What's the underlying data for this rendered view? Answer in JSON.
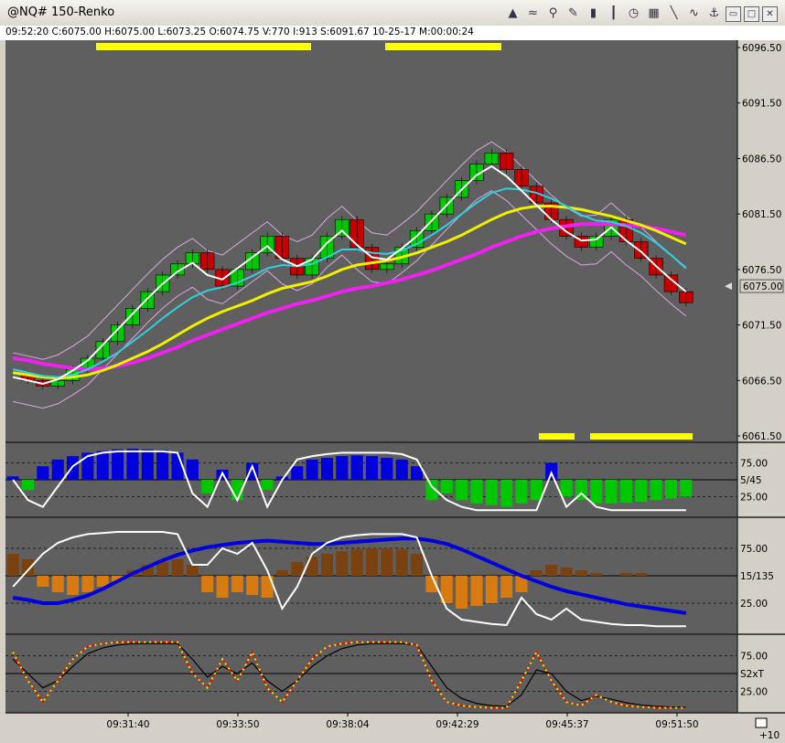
{
  "window": {
    "title": "@NQ# 150-Renko"
  },
  "toolbar": {
    "icons": [
      "chart-type-icon",
      "wave-lines-icon",
      "indicator-icon",
      "pencil-icon",
      "bar-chart-icon",
      "candle-icon",
      "clock-icon",
      "grid-icon",
      "draw-line-icon",
      "trend-icon",
      "pin-icon",
      "restore-icon",
      "maximize-icon",
      "close-icon"
    ],
    "glyphs": [
      "▲",
      "≈",
      "⚲",
      "✎",
      "▮",
      "┃",
      "◷",
      "▦",
      "╲",
      "∿",
      "⚓",
      "▭",
      "□",
      "✕"
    ]
  },
  "info_bar": {
    "text": "09:52:20  C:6075.00  H:6075.00  L:6073.25  O:6074.75  V:770  I:913  S:6091.67  10-25-17  M:00:00:24"
  },
  "price_axis": {
    "ticks": [
      "6096.50",
      "6091.50",
      "6086.50",
      "6081.50",
      "6076.50",
      "6071.50",
      "6066.50",
      "6061.50"
    ],
    "current_price": "6075.00"
  },
  "time_axis": {
    "ticks": [
      "09:31:40",
      "09:33:50",
      "09:38:04",
      "09:42:29",
      "09:45:37",
      "09:51:50"
    ]
  },
  "panels": {
    "panel1": {
      "levels": [
        "75.00",
        "5/45",
        "25.00"
      ]
    },
    "panel2": {
      "levels": [
        "75.00",
        "15/135",
        "25.00"
      ]
    },
    "panel3": {
      "levels": [
        "75.00",
        "S2xT",
        "25.00"
      ]
    }
  },
  "corner_label": "+10",
  "colors": {
    "up": "#00c800",
    "down": "#c80000",
    "sma_fast": "#ffffff",
    "ma_cyan": "#30d0e0",
    "ma_yellow": "#f0f000",
    "ma_magenta": "#f020f0",
    "envelope": "#d8a8e0",
    "bg": "#5f5f5f",
    "osc_blue": "#0000dd",
    "osc_orange": "#d77a10",
    "osc_brown": "#7a4210"
  },
  "chart_data": {
    "type": "renko",
    "title": "@NQ# 150-Renko",
    "ylim": [
      6061.5,
      6096.5
    ],
    "price_path": [
      6067.0,
      6066.5,
      6066.0,
      6066.5,
      6067.5,
      6068.5,
      6070.0,
      6071.5,
      6073.0,
      6074.5,
      6076.0,
      6077.0,
      6078.0,
      6076.5,
      6075.0,
      6076.5,
      6078.0,
      6079.5,
      6077.5,
      6076.0,
      6077.5,
      6079.5,
      6081.0,
      6078.5,
      6076.5,
      6077.0,
      6078.5,
      6080.0,
      6081.5,
      6083.0,
      6084.5,
      6086.0,
      6087.0,
      6085.5,
      6084.0,
      6082.5,
      6081.0,
      6079.5,
      6078.5,
      6079.5,
      6081.0,
      6079.0,
      6077.5,
      6076.0,
      6074.5,
      6073.5
    ],
    "ma_fast": [
      6066.8,
      6066.5,
      6066.2,
      6066.6,
      6067.4,
      6068.3,
      6069.7,
      6071.1,
      6072.5,
      6073.9,
      6075.2,
      6076.3,
      6077.1,
      6076.0,
      6075.6,
      6076.6,
      6077.6,
      6078.6,
      6077.4,
      6076.8,
      6077.4,
      6078.9,
      6080.0,
      6078.7,
      6077.6,
      6077.4,
      6078.4,
      6079.5,
      6080.9,
      6082.3,
      6083.7,
      6085.0,
      6085.8,
      6084.9,
      6083.6,
      6082.3,
      6081.0,
      6079.9,
      6079.1,
      6079.2,
      6080.3,
      6079.1,
      6078.1,
      6076.8,
      6075.6,
      6074.5
    ],
    "ma_cyan": [
      6067.5,
      6067.2,
      6066.9,
      6066.8,
      6067.0,
      6067.5,
      6068.2,
      6069.0,
      6070.0,
      6071.0,
      6072.1,
      6073.1,
      6074.0,
      6074.6,
      6074.9,
      6075.3,
      6075.9,
      6076.6,
      6076.9,
      6076.8,
      6077.0,
      6077.6,
      6078.3,
      6078.3,
      6078.0,
      6077.9,
      6078.2,
      6078.8,
      6079.6,
      6080.5,
      6081.5,
      6082.5,
      6083.4,
      6083.8,
      6083.7,
      6083.4,
      6082.9,
      6082.2,
      6081.4,
      6080.9,
      6080.8,
      6080.4,
      6079.8,
      6078.9,
      6077.8,
      6076.6
    ],
    "ma_yellow": [
      6067.2,
      6067.0,
      6066.8,
      6066.7,
      6066.8,
      6067.0,
      6067.4,
      6067.9,
      6068.5,
      6069.1,
      6069.8,
      6070.6,
      6071.4,
      6072.1,
      6072.7,
      6073.2,
      6073.7,
      6074.3,
      6074.8,
      6075.1,
      6075.4,
      6075.9,
      6076.5,
      6076.9,
      6077.1,
      6077.3,
      6077.6,
      6078.0,
      6078.5,
      6079.0,
      6079.6,
      6080.3,
      6081.0,
      6081.6,
      6082.0,
      6082.2,
      6082.2,
      6082.1,
      6081.9,
      6081.6,
      6081.3,
      6080.9,
      6080.5,
      6080.0,
      6079.4,
      6078.8
    ],
    "ma_magenta": [
      6068.5,
      6068.3,
      6068.0,
      6067.8,
      6067.6,
      6067.5,
      6067.6,
      6067.8,
      6068.1,
      6068.5,
      6069.0,
      6069.5,
      6070.1,
      6070.6,
      6071.1,
      6071.6,
      6072.1,
      6072.6,
      6073.0,
      6073.4,
      6073.7,
      6074.1,
      6074.5,
      6074.8,
      6075.0,
      6075.3,
      6075.6,
      6076.0,
      6076.4,
      6076.9,
      6077.4,
      6077.9,
      6078.5,
      6079.0,
      6079.5,
      6079.9,
      6080.2,
      6080.4,
      6080.6,
      6080.6,
      6080.6,
      6080.5,
      6080.4,
      6080.2,
      6079.9,
      6079.6
    ],
    "panel1": {
      "histogram": [
        10,
        -30,
        40,
        60,
        70,
        80,
        85,
        90,
        92,
        90,
        88,
        80,
        60,
        -40,
        30,
        -60,
        50,
        -30,
        10,
        40,
        60,
        65,
        70,
        72,
        70,
        65,
        60,
        40,
        -60,
        -40,
        -60,
        -70,
        -75,
        -80,
        -70,
        -60,
        50,
        -50,
        -60,
        -70,
        -70,
        -68,
        -65,
        -60,
        -55,
        -50
      ],
      "line": [
        50,
        20,
        10,
        40,
        70,
        85,
        90,
        92,
        92,
        92,
        92,
        90,
        30,
        10,
        60,
        20,
        70,
        10,
        50,
        80,
        85,
        88,
        90,
        90,
        90,
        90,
        88,
        80,
        40,
        20,
        10,
        5,
        5,
        5,
        5,
        5,
        60,
        10,
        30,
        10,
        5,
        5,
        5,
        5,
        5,
        5
      ]
    },
    "panel2": {
      "histogram": [
        40,
        30,
        -20,
        -30,
        -35,
        -30,
        -20,
        -10,
        10,
        20,
        25,
        30,
        20,
        -30,
        -40,
        -30,
        -35,
        -40,
        10,
        25,
        35,
        40,
        45,
        48,
        50,
        50,
        48,
        40,
        -30,
        -50,
        -60,
        -55,
        -50,
        -40,
        -30,
        10,
        20,
        15,
        10,
        5,
        0,
        5,
        5,
        0,
        0,
        0
      ],
      "line_blue": [
        30,
        28,
        25,
        25,
        28,
        32,
        38,
        45,
        52,
        58,
        64,
        69,
        73,
        76,
        78,
        80,
        81,
        82,
        81,
        80,
        79,
        79,
        80,
        81,
        82,
        83,
        84,
        84,
        82,
        79,
        74,
        68,
        62,
        56,
        50,
        45,
        40,
        36,
        33,
        30,
        27,
        24,
        22,
        20,
        18,
        16
      ],
      "line_white": [
        40,
        55,
        70,
        80,
        85,
        88,
        89,
        90,
        90,
        90,
        90,
        88,
        60,
        60,
        75,
        70,
        80,
        55,
        20,
        40,
        70,
        80,
        85,
        87,
        88,
        88,
        88,
        85,
        50,
        20,
        10,
        8,
        6,
        5,
        30,
        15,
        10,
        20,
        10,
        8,
        6,
        5,
        5,
        4,
        4,
        4
      ]
    },
    "panel3": {
      "fast": [
        80,
        40,
        10,
        40,
        70,
        88,
        92,
        94,
        94,
        94,
        94,
        94,
        50,
        30,
        70,
        40,
        80,
        30,
        10,
        40,
        70,
        88,
        92,
        94,
        94,
        94,
        94,
        90,
        40,
        10,
        5,
        3,
        2,
        2,
        40,
        80,
        40,
        10,
        5,
        20,
        10,
        5,
        3,
        2,
        2,
        2
      ],
      "slow": [
        70,
        50,
        30,
        40,
        60,
        78,
        86,
        90,
        92,
        92,
        92,
        92,
        70,
        45,
        60,
        50,
        65,
        40,
        25,
        40,
        60,
        75,
        85,
        90,
        92,
        92,
        92,
        90,
        60,
        30,
        15,
        8,
        5,
        4,
        20,
        55,
        50,
        25,
        12,
        18,
        14,
        9,
        6,
        4,
        3,
        3
      ]
    }
  }
}
